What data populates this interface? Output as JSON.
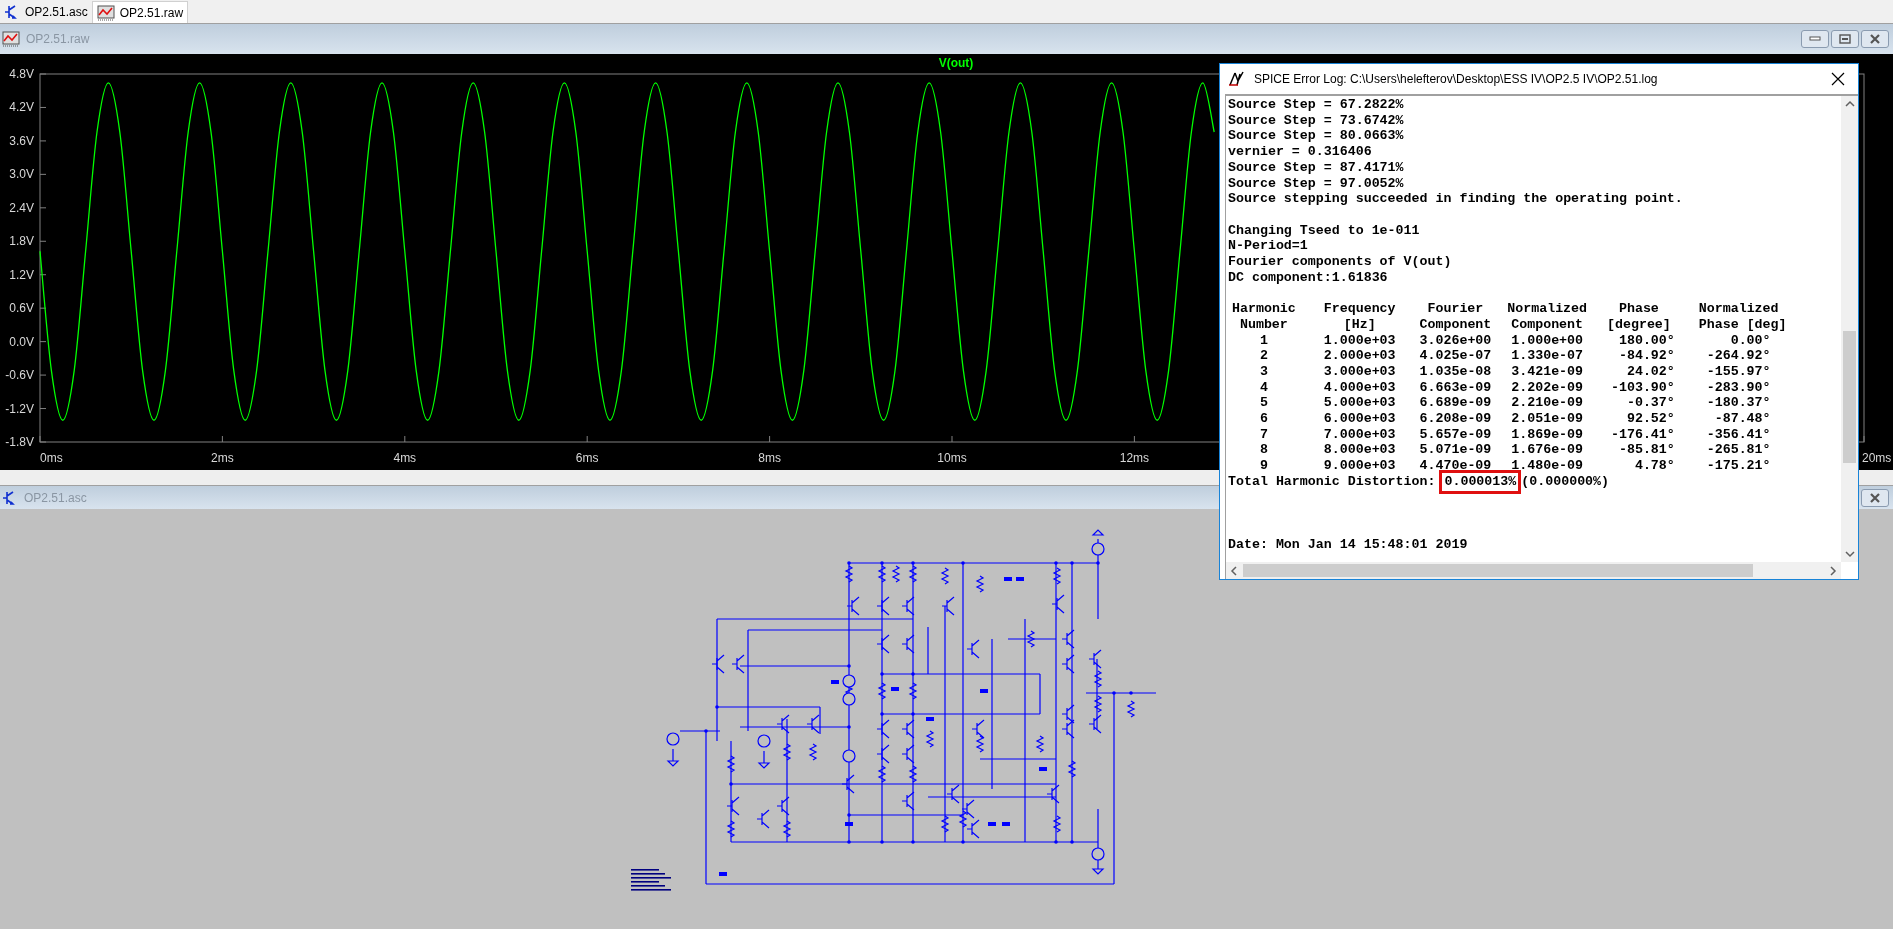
{
  "tabs": [
    {
      "label": "OP2.51.asc",
      "kind": "schematic",
      "selected": false
    },
    {
      "label": "OP2.51.raw",
      "kind": "waveform",
      "selected": true
    }
  ],
  "waveform_window": {
    "title": "OP2.51.raw",
    "chart_data": {
      "type": "line",
      "xlim": [
        0,
        20
      ],
      "ylim": [
        -1.8,
        4.8
      ],
      "x": [
        0,
        0.125,
        0.25,
        0.375,
        0.5,
        0.625,
        0.75,
        0.875,
        1,
        1.125,
        1.25,
        1.375,
        1.5,
        1.625,
        1.75,
        1.875,
        2,
        2.125,
        2.25,
        2.375,
        2.5,
        2.625,
        2.75,
        2.875,
        3,
        3.125,
        3.25,
        3.375,
        3.5,
        3.625,
        3.75,
        3.875,
        4,
        4.125,
        4.25,
        4.375,
        4.5,
        4.625,
        4.75,
        4.875,
        5,
        5.125,
        5.25,
        5.375,
        5.5,
        5.625,
        5.75,
        5.875,
        6,
        6.125,
        6.25,
        6.375,
        6.5,
        6.625,
        6.75,
        6.875,
        7,
        7.125,
        7.25,
        7.375,
        7.5,
        7.625,
        7.75,
        7.875,
        8,
        8.125,
        8.25,
        8.375,
        8.5,
        8.625,
        8.75,
        8.875,
        9,
        9.125,
        9.25,
        9.375,
        9.5,
        9.625,
        9.75,
        9.875,
        10,
        10.125,
        10.25,
        10.375,
        10.5,
        10.625,
        10.75,
        10.875,
        11,
        11.125,
        11.25,
        11.375,
        11.5,
        11.625,
        11.75,
        11.875,
        12,
        12.125,
        12.25,
        12.375,
        12.5,
        12.625,
        12.75,
        12.875
      ],
      "xticks": [
        {
          "value": 0,
          "label": "0ms"
        },
        {
          "value": 2,
          "label": "2ms"
        },
        {
          "value": 4,
          "label": "4ms"
        },
        {
          "value": 6,
          "label": "6ms"
        },
        {
          "value": 8,
          "label": "8ms"
        },
        {
          "value": 10,
          "label": "10ms"
        },
        {
          "value": 12,
          "label": "12ms"
        },
        {
          "value": 20,
          "label": "20ms"
        }
      ],
      "yticks": [
        {
          "value": 4.8,
          "label": "4.8V"
        },
        {
          "value": 4.2,
          "label": "4.2V"
        },
        {
          "value": 3.6,
          "label": "3.6V"
        },
        {
          "value": 3.0,
          "label": "3.0V"
        },
        {
          "value": 2.4,
          "label": "2.4V"
        },
        {
          "value": 1.8,
          "label": "1.8V"
        },
        {
          "value": 1.2,
          "label": "1.2V"
        },
        {
          "value": 0.6,
          "label": "0.6V"
        },
        {
          "value": 0,
          "label": "0.0V"
        },
        {
          "value": -0.6,
          "label": "-0.6V"
        },
        {
          "value": -1.2,
          "label": "-1.2V"
        },
        {
          "value": -1.8,
          "label": "-1.8V"
        }
      ],
      "series": [
        {
          "name": "V(out)",
          "color": "#00ff00",
          "values": [
            1.62,
            -0.52,
            -1.41,
            -0.52,
            1.62,
            3.76,
            4.64,
            3.76,
            1.62,
            -0.52,
            -1.41,
            -0.52,
            1.62,
            3.76,
            4.64,
            3.76,
            1.62,
            -0.52,
            -1.41,
            -0.52,
            1.62,
            3.76,
            4.64,
            3.76,
            1.62,
            -0.52,
            -1.41,
            -0.52,
            1.62,
            3.76,
            4.64,
            3.76,
            1.62,
            -0.52,
            -1.41,
            -0.52,
            1.62,
            3.76,
            4.64,
            3.76,
            1.62,
            -0.52,
            -1.41,
            -0.52,
            1.62,
            3.76,
            4.64,
            3.76,
            1.62,
            -0.52,
            -1.41,
            -0.52,
            1.62,
            3.76,
            4.64,
            3.76,
            1.62,
            -0.52,
            -1.41,
            -0.52,
            1.62,
            3.76,
            4.64,
            3.76,
            1.62,
            -0.52,
            -1.41,
            -0.52,
            1.62,
            3.76,
            4.64,
            3.76,
            1.62,
            -0.52,
            -1.41,
            -0.52,
            1.62,
            3.76,
            4.64,
            3.76,
            1.62,
            -0.52,
            -1.41,
            -0.52,
            1.62,
            3.76,
            4.64,
            3.76,
            1.62,
            -0.52,
            -1.41,
            -0.52,
            1.62,
            3.76,
            4.64,
            3.76,
            1.62,
            -0.52,
            -1.41,
            -0.52,
            1.62,
            3.76,
            4.64,
            3.76
          ]
        }
      ]
    }
  },
  "schematic_window": {
    "title": "OP2.51.asc"
  },
  "log_window": {
    "title": "SPICE Error Log: C:\\Users\\helefterov\\Desktop\\ESS IV\\OP2.5 IV\\OP2.51.log",
    "blocks": [
      [
        "Source Step = 67.2822%",
        "Source Step = 73.6742%",
        "Source Step = 80.0663%",
        "vernier = 0.316406",
        "Source Step = 87.4171%",
        "Source Step = 97.0052%",
        "Source stepping succeeded in finding the operating point."
      ],
      [
        "Changing Tseed to 1e-011",
        "N-Period=1",
        "Fourier components of V(out)",
        "DC component:1.61836"
      ]
    ],
    "table": {
      "header_rows": [
        [
          "Harmonic",
          "Frequency",
          "Fourier",
          "Normalized",
          "Phase",
          "Normalized"
        ],
        [
          "Number",
          "[Hz]",
          "Component",
          "Component",
          "[degree]",
          "Phase [deg]"
        ]
      ],
      "rows": [
        [
          "1",
          "1.000e+03",
          "3.026e+00",
          "1.000e+00",
          "180.00°",
          "0.00°"
        ],
        [
          "2",
          "2.000e+03",
          "4.025e-07",
          "1.330e-07",
          "-84.92°",
          "-264.92°"
        ],
        [
          "3",
          "3.000e+03",
          "1.035e-08",
          "3.421e-09",
          "24.02°",
          "-155.97°"
        ],
        [
          "4",
          "4.000e+03",
          "6.663e-09",
          "2.202e-09",
          "-103.90°",
          "-283.90°"
        ],
        [
          "5",
          "5.000e+03",
          "6.689e-09",
          "2.210e-09",
          "-0.37°",
          "-180.37°"
        ],
        [
          "6",
          "6.000e+03",
          "6.208e-09",
          "2.051e-09",
          "92.52°",
          "-87.48°"
        ],
        [
          "7",
          "7.000e+03",
          "5.657e-09",
          "1.869e-09",
          "-176.41°",
          "-356.41°"
        ],
        [
          "8",
          "8.000e+03",
          "5.071e-09",
          "1.676e-09",
          "-85.81°",
          "-265.81°"
        ],
        [
          "9",
          "9.000e+03",
          "4.470e-09",
          "1.480e-09",
          "4.78°",
          "-175.21°"
        ]
      ]
    },
    "thd": {
      "label": "Total Harmonic Distortion:",
      "value": "0.000013%",
      "highlighted": true,
      "rest": "(0.000000%)"
    },
    "date": "Date: Mon Jan 14 15:48:01 2019"
  }
}
